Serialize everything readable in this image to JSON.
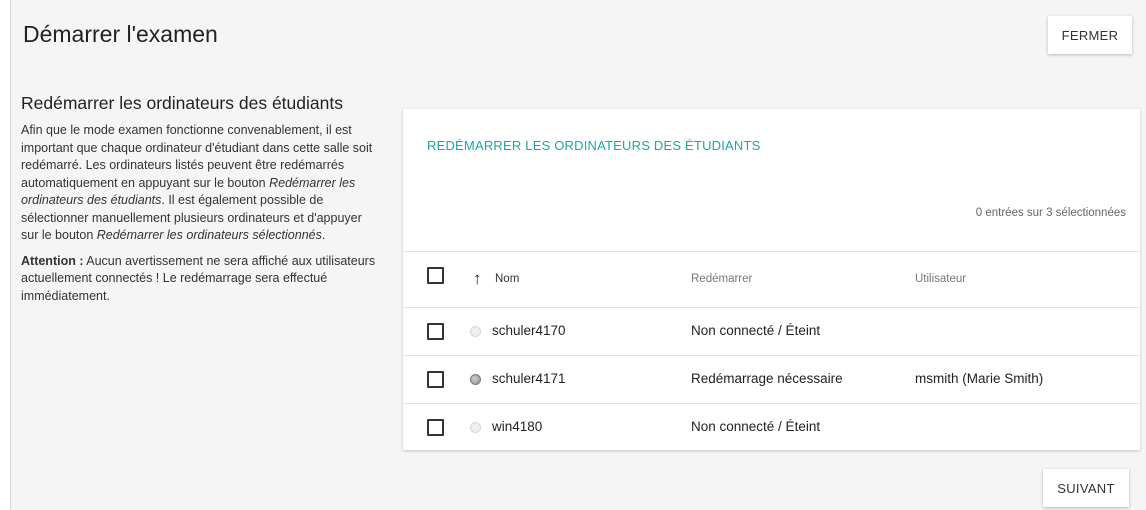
{
  "header": {
    "title": "Démarrer l'examen",
    "close_label": "FERMER"
  },
  "side": {
    "heading": "Redémarrer les ordinateurs des étudiants",
    "p1_a": "Afin que le mode examen fonctionne convenablement, il est important que chaque ordinateur d'étudiant dans cette salle soit redémarré. Les ordinateurs listés peuvent être redémarrés automatiquement en appuyant sur le bouton ",
    "p1_em1": "Redémarrer les ordinateurs des étudiants",
    "p1_b": ". Il est également possible de sélectionner manuellement plusieurs ordinateurs et d'appuyer sur le bouton ",
    "p1_em2": "Redémarrer les ordinateurs sélectionnés",
    "p1_c": ".",
    "p2_strong": "Attention :",
    "p2_text": " Aucun avertissement ne sera affiché aux utilisateurs actuellement connectés ! Le redémarrage sera effectué immédiatement."
  },
  "card": {
    "title": "REDÉMARRER LES ORDINATEURS DES ÉTUDIANTS",
    "selection_count": "0 entrées sur 3 sélectionnées",
    "columns": {
      "name": "Nom",
      "restart": "Redémarrer",
      "user": "Utilisateur"
    },
    "sort_icon": "arrow-up-icon",
    "rows": [
      {
        "name": "schuler4170",
        "restart": "Non connecté / Éteint",
        "user": "",
        "status": "off"
      },
      {
        "name": "schuler4171",
        "restart": "Redémarrage nécessaire",
        "user": "msmith (Marie Smith)",
        "status": "on"
      },
      {
        "name": "win4180",
        "restart": "Non connecté / Éteint",
        "user": "",
        "status": "off"
      }
    ]
  },
  "footer": {
    "next_label": "SUIVANT"
  },
  "colors": {
    "accent": "#1aa7a8",
    "background": "#f5f5f5"
  }
}
